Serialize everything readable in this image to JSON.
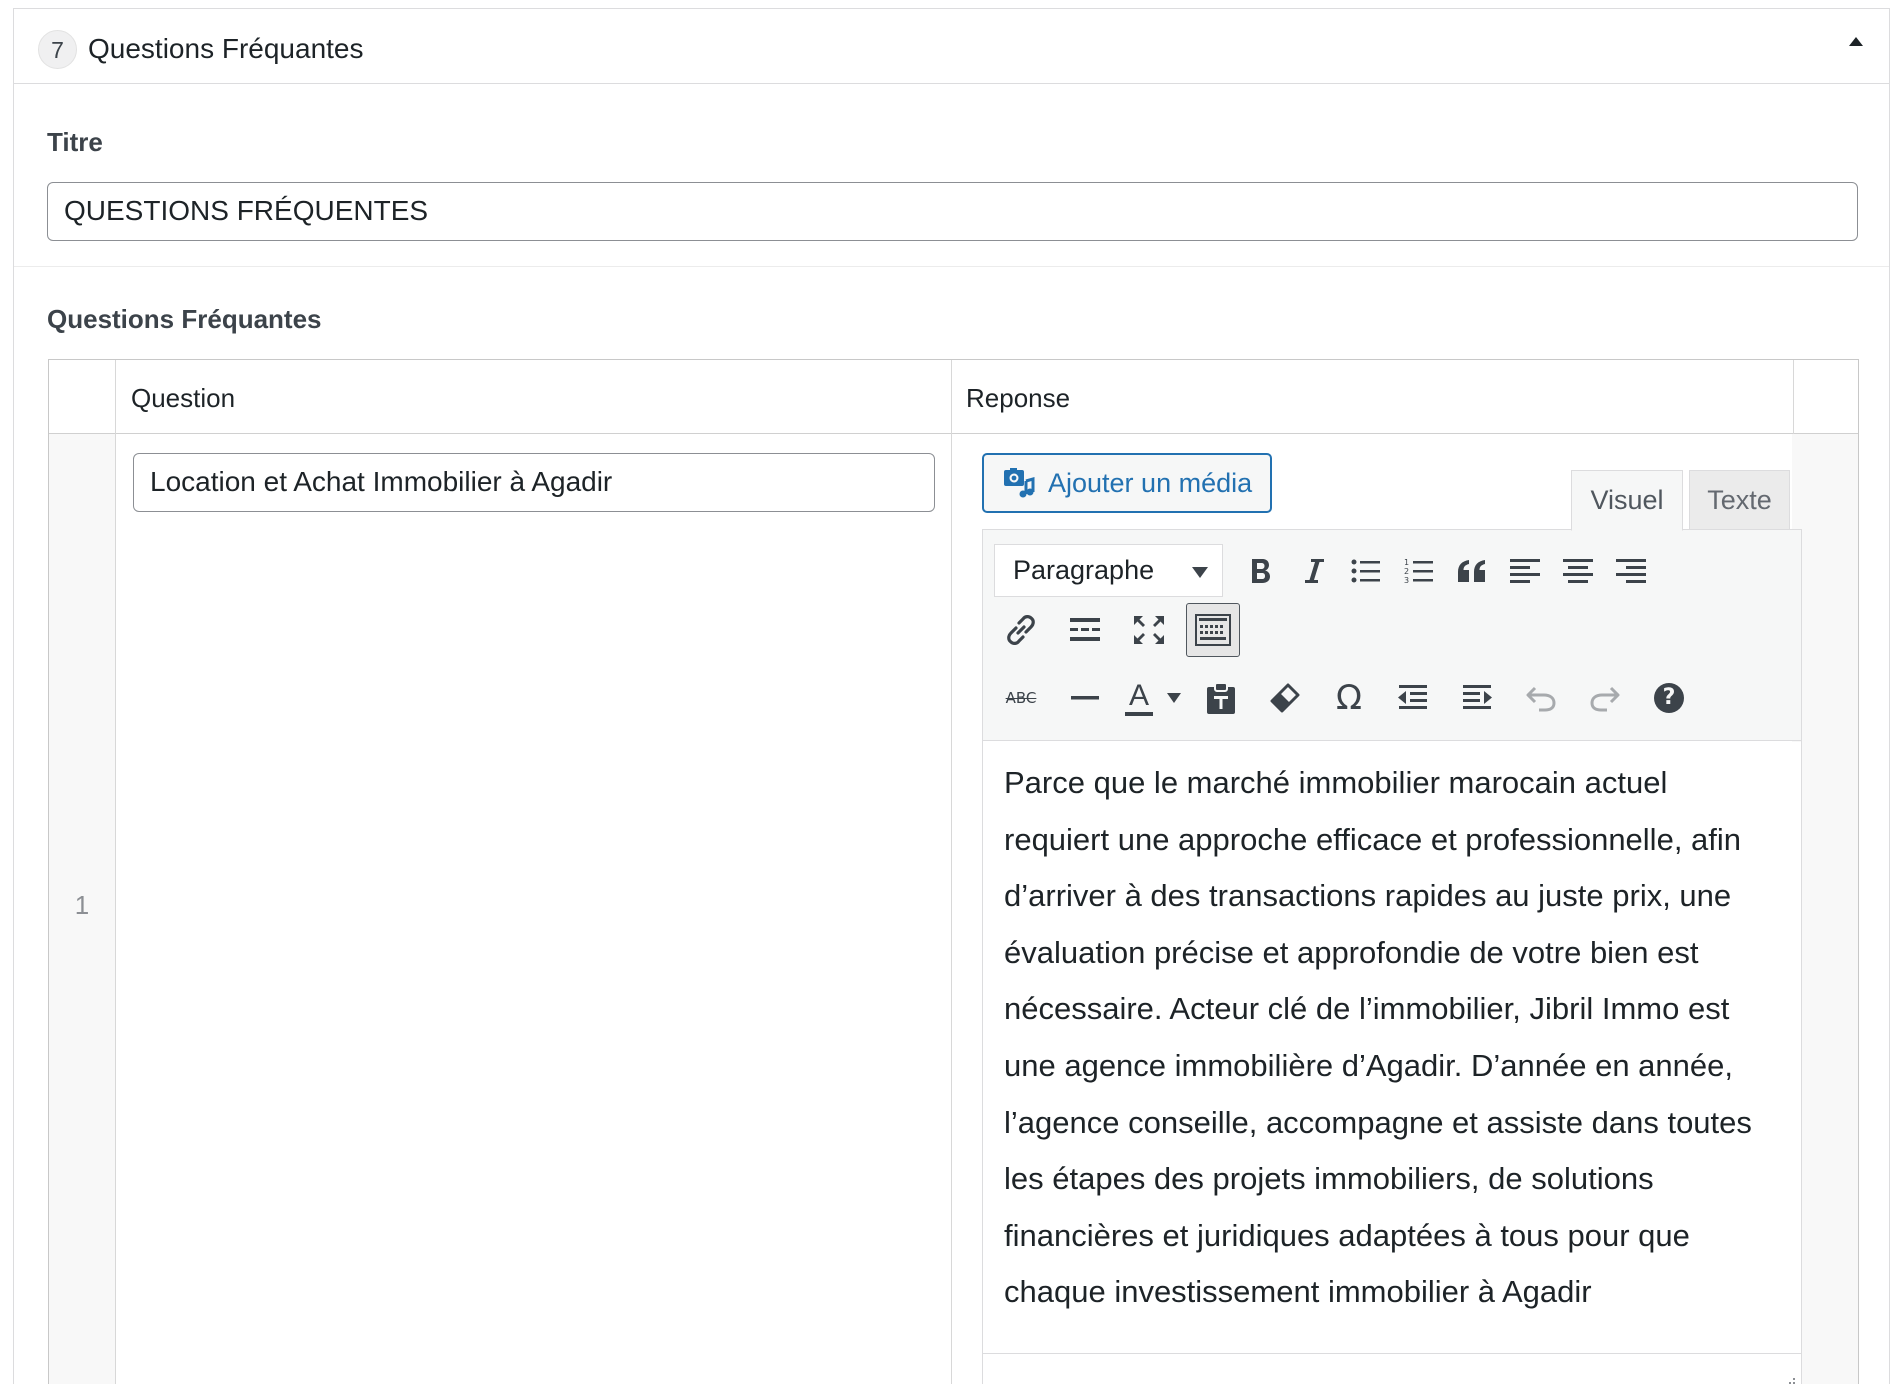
{
  "section": {
    "number": "7",
    "title": "Questions Fréquantes"
  },
  "titre_field": {
    "label": "Titre",
    "value": "QUESTIONS FRÉQUENTES"
  },
  "faq": {
    "label": "Questions Fréquantes",
    "columns": [
      "Question",
      "Reponse"
    ],
    "rows": [
      {
        "index": "1",
        "question": "Location et Achat Immobilier à Agadir"
      }
    ]
  },
  "editor": {
    "media_button": "Ajouter un média",
    "tabs": [
      "Visuel",
      "Texte"
    ],
    "active_tab": "Visuel",
    "format_select": "Paragraphe",
    "content": "Parce que le marché immobilier marocain actuel requiert une approche efficace et professionnelle, afin d’arriver à des transactions rapides au juste prix, une évaluation précise et approfondie de votre bien est nécessaire. Acteur clé de l’immobilier, Jibril Immo est une agence immobilière d’Agadir. D’année en année, l’agence conseille, accompagne et assiste dans toutes les étapes des projets immobiliers, de solutions financières et juridiques adaptées à tous pour que chaque investissement immobilier à Agadir",
    "toolbar_icons": [
      "bold-icon",
      "italic-icon",
      "bullet-list-icon",
      "numbered-list-icon",
      "blockquote-icon",
      "align-left-icon",
      "align-center-icon",
      "align-right-icon",
      "link-icon",
      "read-more-icon",
      "fullscreen-icon",
      "toolbar-toggle-icon",
      "strikethrough-icon",
      "horizontal-line-icon",
      "text-color-icon",
      "paste-as-text-icon",
      "clear-formatting-icon",
      "special-character-icon",
      "outdent-icon",
      "indent-icon",
      "undo-icon",
      "redo-icon",
      "help-icon"
    ],
    "strikethrough_glyph": "ABC",
    "text_color_glyph": "A",
    "special_char_glyph": "Ω",
    "help_glyph": "?"
  },
  "colors": {
    "accent": "#2271b1",
    "border": "#dcdcde",
    "text": "#1d2327"
  }
}
